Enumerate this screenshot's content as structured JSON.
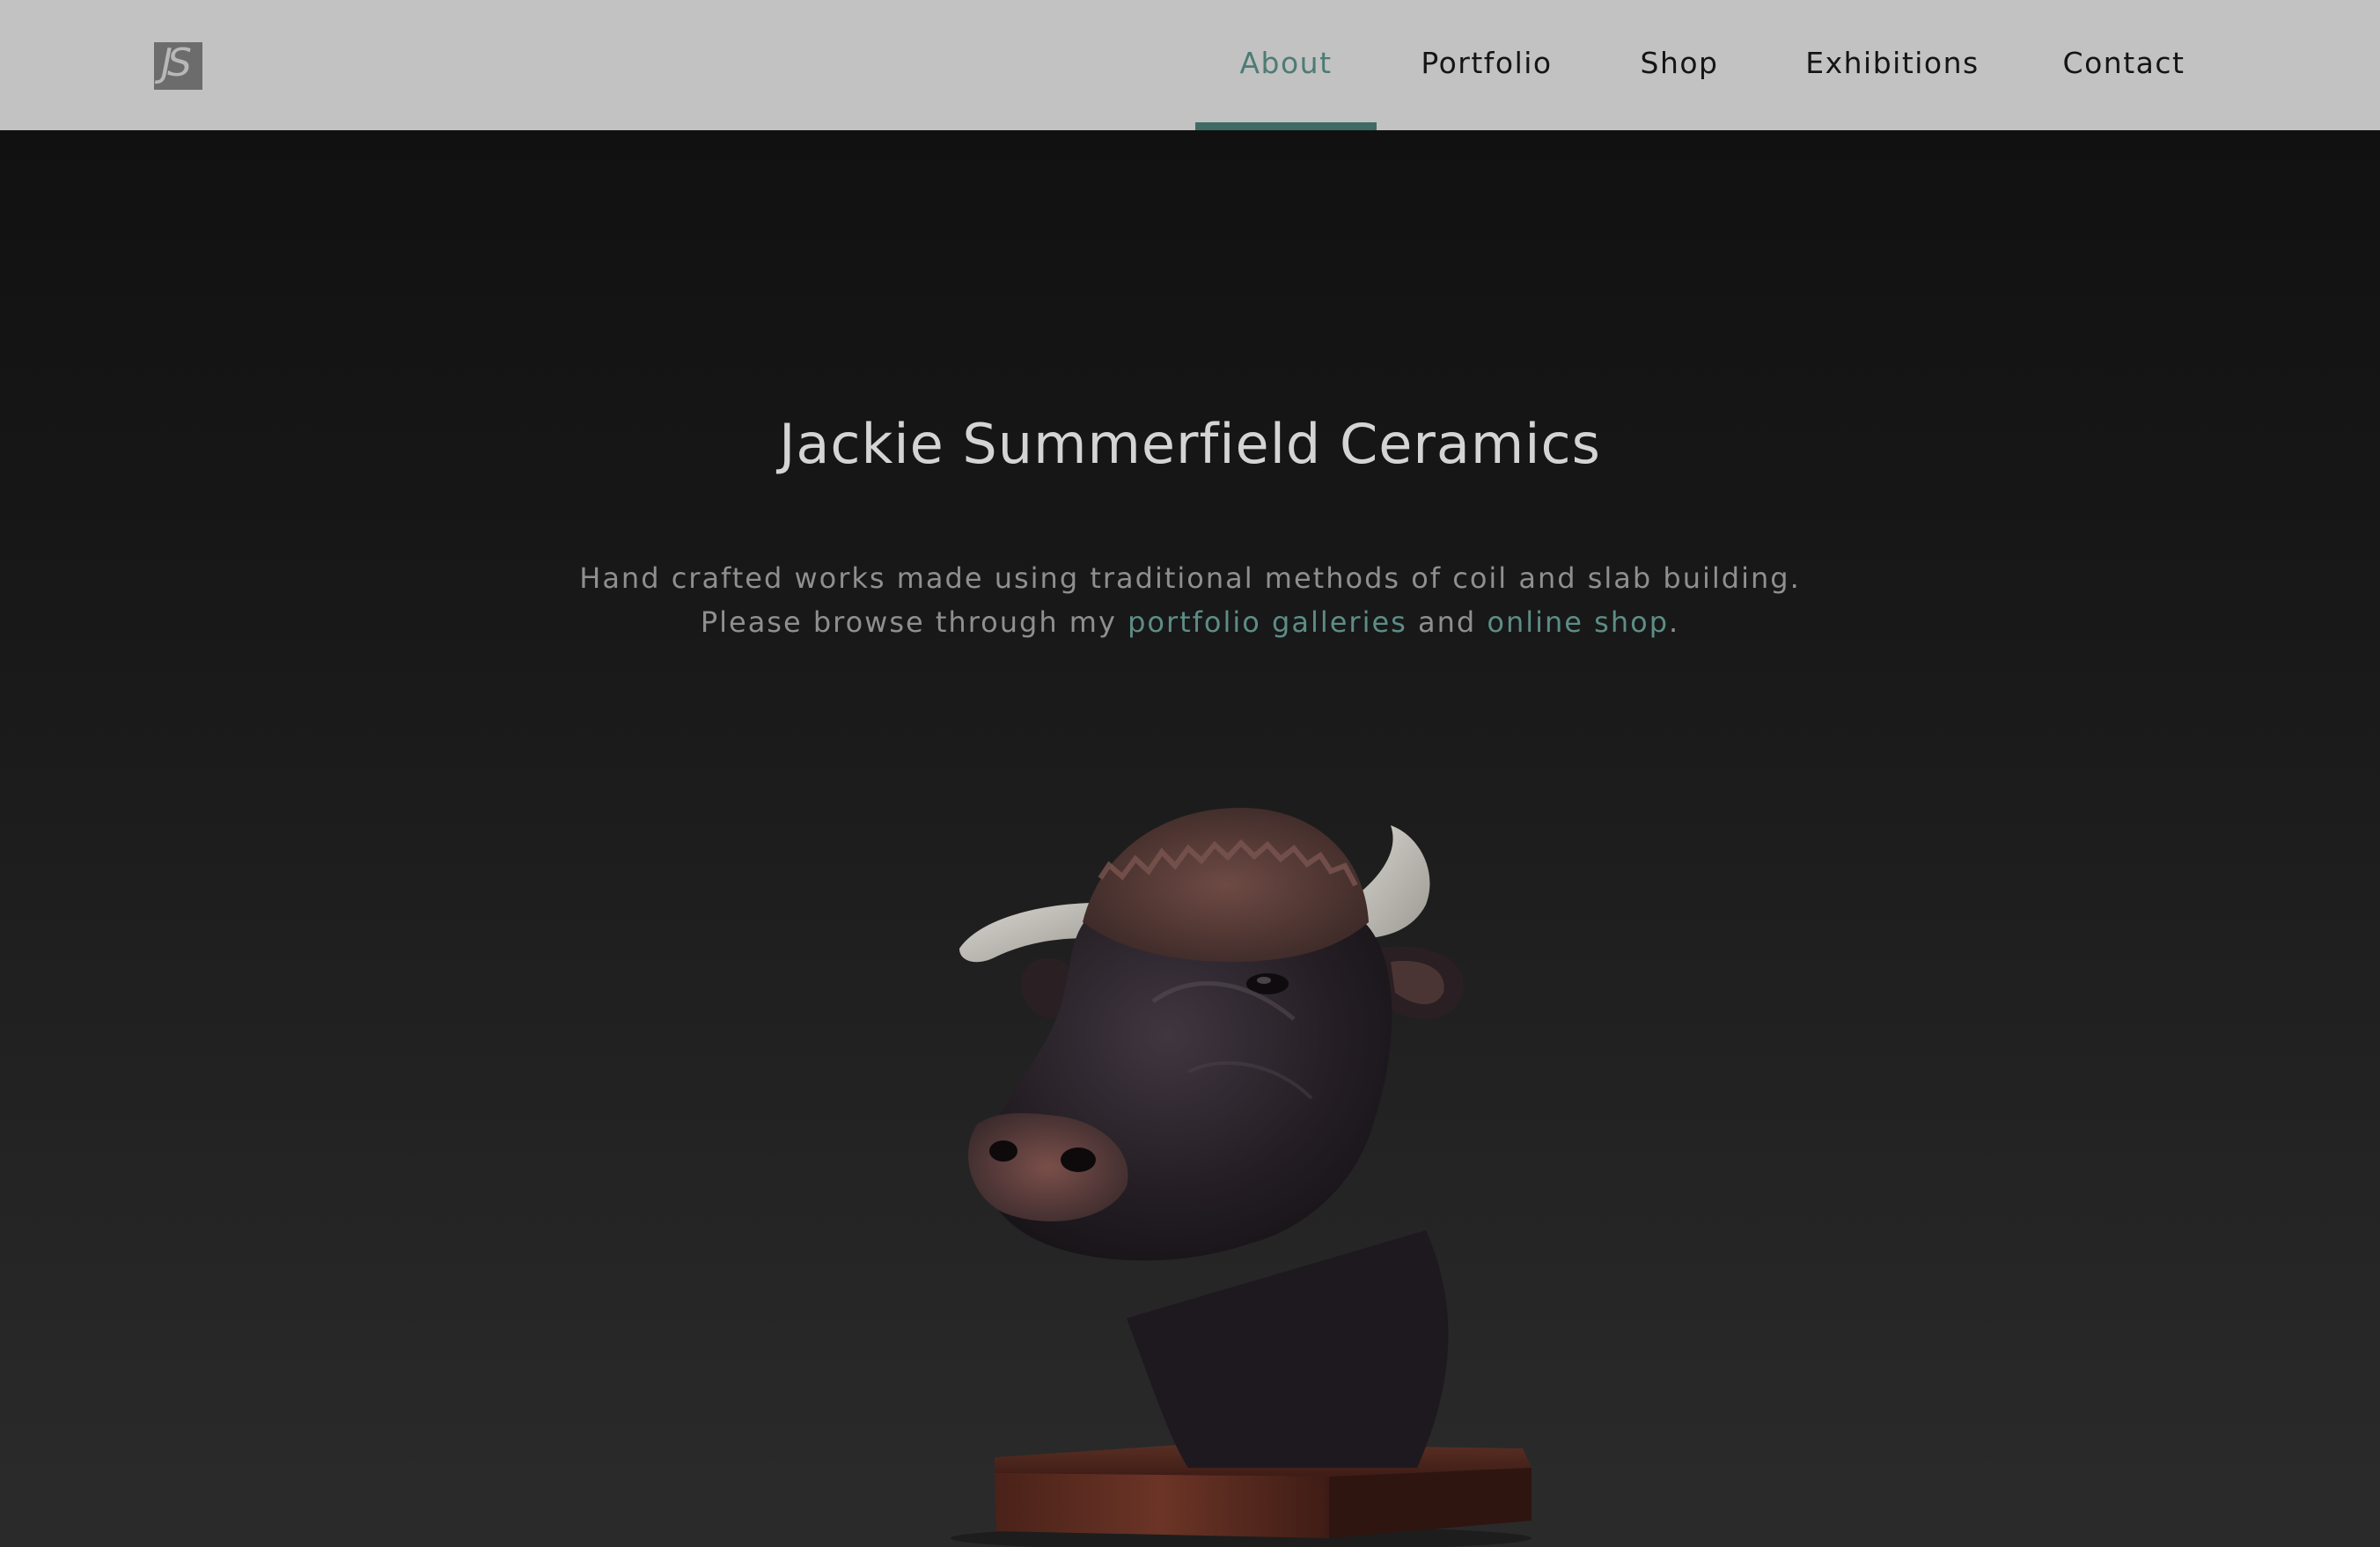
{
  "header": {
    "logo_text": "JS",
    "nav": [
      {
        "label": "About",
        "active": true
      },
      {
        "label": "Portfolio",
        "active": false
      },
      {
        "label": "Shop",
        "active": false
      },
      {
        "label": "Exhibitions",
        "active": false
      },
      {
        "label": "Contact",
        "active": false
      }
    ],
    "accent_color": "#4e7b74"
  },
  "hero": {
    "title": "Jackie Summerfield Ceramics",
    "intro_start": "Hand crafted works made using traditional methods of coil and slab building. Please browse through my ",
    "link_portfolio": "portfolio galleries",
    "intro_mid": " and ",
    "link_shop": "online shop",
    "intro_end": ".",
    "link_color": "#5d8d86"
  },
  "featured_image": {
    "subject": "ceramic bull head sculpture on wooden plinth"
  }
}
